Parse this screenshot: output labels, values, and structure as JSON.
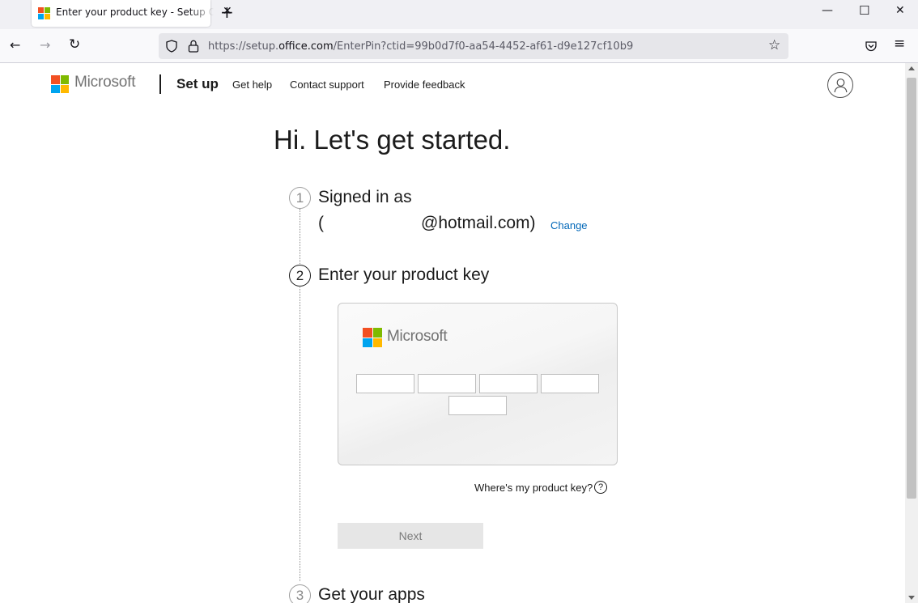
{
  "browser": {
    "tab_title": "Enter your product key - Setup Office",
    "tab_close": "✕",
    "new_tab": "+",
    "window_controls": {
      "minimize": "—",
      "maximize": "☐",
      "close": "✕"
    },
    "nav": {
      "back": "←",
      "forward": "→",
      "reload": "↻"
    },
    "url_prefix": "https://setup.",
    "url_domain": "office.com",
    "url_path": "/EnterPin?ctid=99b0d7f0-aa54-4452-af61-d9e127cf10b9",
    "bookmark": "☆",
    "pocket": "◫",
    "menu": "≡",
    "icons": [
      "shield-icon",
      "lock-icon",
      "star-icon",
      "pocket-icon",
      "hamburger-menu-icon"
    ]
  },
  "header": {
    "brand": "Microsoft",
    "section": "Set up",
    "links": [
      "Get help",
      "Contact support",
      "Provide feedback"
    ]
  },
  "main": {
    "heading": "Hi. Let's get started.",
    "steps": [
      {
        "number": "1",
        "title": "Signed in as"
      },
      {
        "number": "2",
        "title": "Enter your product key"
      },
      {
        "number": "3",
        "title": "Get your apps"
      }
    ],
    "account_open_paren": "(",
    "account_email": "@hotmail.com)",
    "change_link": "Change",
    "card_brand": "Microsoft",
    "key_fields": [
      "",
      "",
      "",
      "",
      ""
    ],
    "where_link": "Where's my product key?",
    "help_glyph": "?",
    "next_button": "Next"
  },
  "colors": {
    "ms_red": "#f25022",
    "ms_green": "#7fba00",
    "ms_blue": "#00a4ef",
    "ms_yellow": "#ffb900",
    "link_blue": "#0067b8"
  }
}
